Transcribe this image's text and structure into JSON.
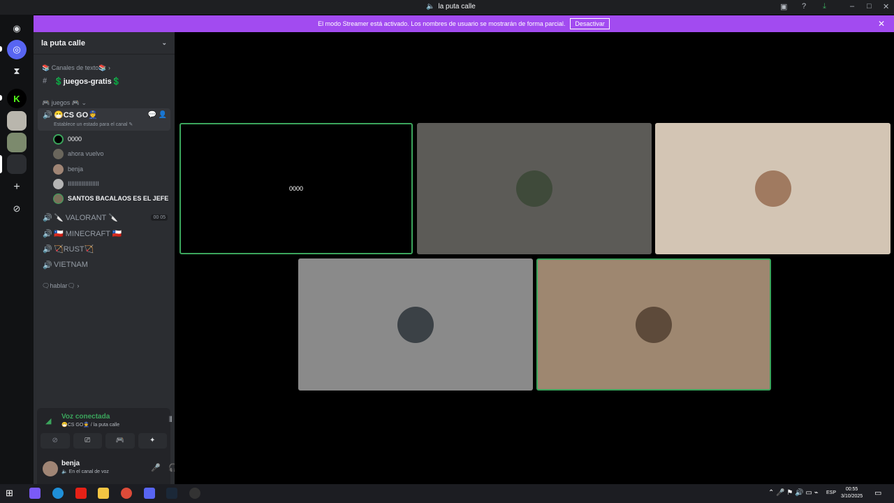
{
  "window": {
    "title": "la puta calle"
  },
  "banner": {
    "message": "El modo Streamer está activado. Los nombres de usuario se mostrarán de forma parcial.",
    "button_label": "Desactivar"
  },
  "server": {
    "name": "la puta calle"
  },
  "text_category": "📚 Canales de texto📚",
  "text_channel": "💲juegos-gratis💲",
  "voice_category": "🎮 juegos 🎮",
  "active_channel": {
    "name": "😷CS GO👮",
    "status_placeholder": "Establece un estado para el canal"
  },
  "voice_users": [
    {
      "name": "0000"
    },
    {
      "name": "ahora vuelvo"
    },
    {
      "name": "benja"
    },
    {
      "name": "IIIIIIIIIIIIIIIIII"
    },
    {
      "name": "SANTOS BACALAOS ES EL JEFE"
    }
  ],
  "other_channels": [
    {
      "name": "🔪 VALORANT 🔪",
      "badge_a": "00",
      "badge_b": "05"
    },
    {
      "name": "🇨🇱 MINECRAFT 🇨🇱"
    },
    {
      "name": "🏹RUST🏹"
    },
    {
      "name": "VIETNAM"
    }
  ],
  "hablar_category": "🗨hablar🗨",
  "voice_panel": {
    "status": "Voz conectada",
    "location": "😷CS GO👮 / la puta calle"
  },
  "current_user": {
    "name": "benja",
    "status": "En el canal de voz"
  },
  "tiles": [
    {
      "label": "0000",
      "bg": "#000000",
      "speaking": true
    },
    {
      "bg": "#5c5b57",
      "speaking": false
    },
    {
      "bg": "#d3c5b4",
      "speaking": false
    },
    {
      "bg": "#8a8a8a",
      "speaking": false
    },
    {
      "bg": "#9e8770",
      "speaking": true
    }
  ],
  "taskbar": {
    "lang": "ESP",
    "time": "00:55",
    "date": "3/10/2025"
  },
  "colors": {
    "accent": "#a24bf0",
    "speaking": "#3ba55c",
    "voice_connected": "#3ba55c"
  }
}
